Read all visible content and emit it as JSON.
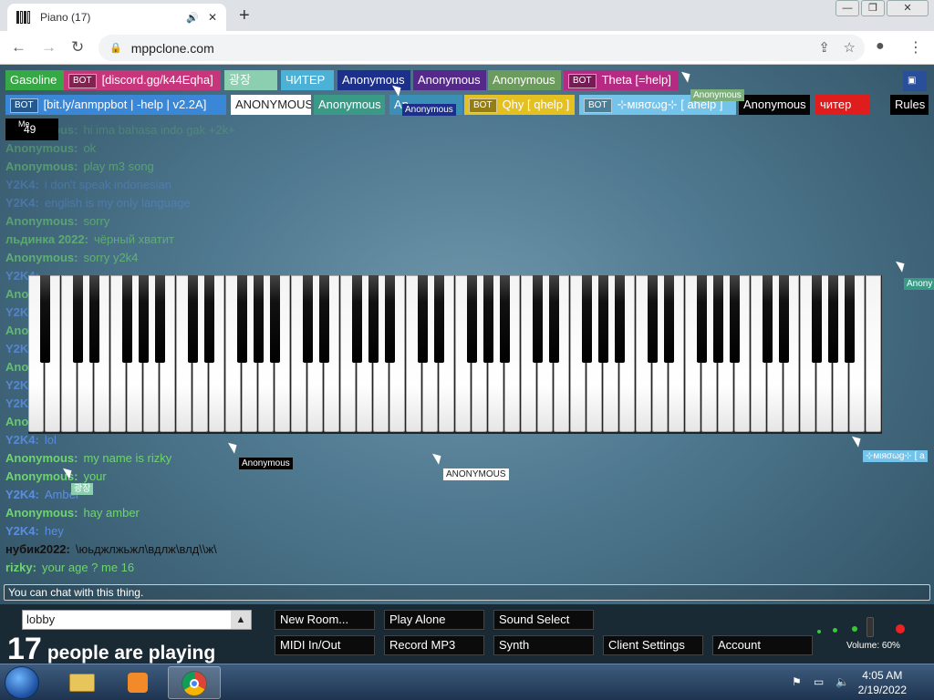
{
  "browser": {
    "tab_title": "Piano (17)",
    "url": "mppclone.com",
    "new_tab": "+",
    "minimize": "—",
    "restore": "❐",
    "close": "✕"
  },
  "users_row1": [
    {
      "name": "Gasoline",
      "bg": "#36a845",
      "bot": false
    },
    {
      "name": "[discord.gg/k44Eqha]",
      "bg": "#c7357a",
      "bot": true
    },
    {
      "name": "광장",
      "bg": "#8ccfb0",
      "bot": false
    },
    {
      "name": "ЧИТЕР",
      "bg": "#4bb1d6",
      "bot": false
    },
    {
      "name": "Anonymous",
      "bg": "#1c2f8a",
      "bot": false
    },
    {
      "name": "Anonymous",
      "bg": "#54298a",
      "bot": false
    },
    {
      "name": "Anonymous",
      "bg": "#6c9b5e",
      "bot": false
    },
    {
      "name": "Theta [=help]",
      "bg": "#b52a82",
      "bot": true
    }
  ],
  "users_row2": [
    {
      "name": "[bit.ly/anmppbot | -help | v2.2A]",
      "bg": "#3a87d8",
      "bot": true
    },
    {
      "name": "ANONYMOUS",
      "bg": "#ffffff",
      "fg": "#222",
      "bot": false
    },
    {
      "name": "Anonymous",
      "bg": "#3b9a86",
      "bot": false
    },
    {
      "name": "An",
      "bg": "#3b8fb6",
      "bot": false
    },
    {
      "name": "Qhy [ qhelp ]",
      "bg": "#e5c021",
      "bot": true
    },
    {
      "name": "⊹мιяσωg⊹ [ ahelp ]",
      "bg": "#74c3ea",
      "bot": true
    },
    {
      "name": "Anonymous",
      "bg": "#050505",
      "bot": false
    },
    {
      "name": "читер",
      "bg": "#e01d1d",
      "bot": false
    }
  ],
  "bot_badge": "BOT",
  "rules_label": "Rules",
  "me": {
    "label": "Me",
    "count": "49"
  },
  "chat": [
    {
      "user": "Anonymous:",
      "text": "hi ima bahasa indo gak +2k+",
      "color": "#6fd46f",
      "fade": 0.25
    },
    {
      "user": "Anonymous:",
      "text": "ok",
      "color": "#6fd46f",
      "fade": 0.4
    },
    {
      "user": "Anonymous:",
      "text": "play m3 song",
      "color": "#6fd46f",
      "fade": 0.5
    },
    {
      "user": "Y2K4:",
      "text": "i don't speak indonesian",
      "color": "#5b8ee0",
      "fade": 0.4
    },
    {
      "user": "Y2K4:",
      "text": "english is my only language",
      "color": "#5b8ee0",
      "fade": 0.45
    },
    {
      "user": "Anonymous:",
      "text": "sorry",
      "color": "#6fd46f",
      "fade": 0.55
    },
    {
      "user": "льдинка 2022:",
      "text": "чёрный хватит",
      "color": "#6fd46f",
      "fade": 0.6
    },
    {
      "user": "Anonymous:",
      "text": "sorry y2k4",
      "color": "#6fd46f",
      "fade": 0.65
    },
    {
      "user": "Y2K4:",
      "text": "",
      "color": "#5b8ee0",
      "fade": 0.7
    },
    {
      "user": "Anonymous:",
      "text": "",
      "color": "#6fd46f",
      "fade": 0.7
    },
    {
      "user": "Y2K4:",
      "text": "",
      "color": "#5b8ee0",
      "fade": 0.75
    },
    {
      "user": "Anonymous:",
      "text": "",
      "color": "#6fd46f",
      "fade": 0.75
    },
    {
      "user": "Y2K4:",
      "text": "",
      "color": "#5b8ee0",
      "fade": 0.8
    },
    {
      "user": "Anonymous:",
      "text": "",
      "color": "#6fd46f",
      "fade": 0.8
    },
    {
      "user": "Y2K4:",
      "text": "",
      "color": "#5b8ee0",
      "fade": 0.85
    },
    {
      "user": "Y2K4:",
      "text": "",
      "color": "#5b8ee0",
      "fade": 0.85
    },
    {
      "user": "Anonymous:",
      "text": "",
      "color": "#6fd46f",
      "fade": 0.9
    },
    {
      "user": "Y2K4:",
      "text": "lol",
      "color": "#5b8ee0",
      "fade": 0.9
    },
    {
      "user": "Anonymous:",
      "text": "my name is rizky",
      "color": "#6fd46f",
      "fade": 1
    },
    {
      "user": "Anonymous:",
      "text": "your",
      "color": "#6fd46f",
      "fade": 1
    },
    {
      "user": "Y2K4:",
      "text": "Amber",
      "color": "#5b8ee0",
      "fade": 1
    },
    {
      "user": "Anonymous:",
      "text": "hay amber",
      "color": "#6fd46f",
      "fade": 1
    },
    {
      "user": "Y2K4:",
      "text": "hey",
      "color": "#5b8ee0",
      "fade": 1
    },
    {
      "user": "нубик2022:",
      "text": "\\юьджлжьжл\\вдлж\\влд\\\\ж\\",
      "color": "#111111",
      "fade": 1
    },
    {
      "user": "rizky:",
      "text": "your age ? me 16",
      "color": "#6fd46f",
      "fade": 1
    }
  ],
  "chat_placeholder": "You can chat with this thing.",
  "cursor_labels": [
    {
      "text": "Anonymous",
      "bg": "#7bb07a"
    },
    {
      "text": "Anonymous",
      "bg": "#1c2f8a"
    },
    {
      "text": "Anony",
      "bg": "#3b9a86"
    },
    {
      "text": "Anonymous",
      "bg": "#050505"
    },
    {
      "text": "ANONYMOUS",
      "bg": "#ffffff",
      "fg": "#222"
    },
    {
      "text": "광장",
      "bg": "#8ccfb0"
    },
    {
      "text": "⊹мιяσωg⊹ [ a",
      "bg": "#74c3ea"
    },
    {
      "text": "Qhy [ qhelp ]",
      "bg": "#e5c021",
      "fg": "#222"
    },
    {
      "text": "Anonymous",
      "bg": "#54298a"
    },
    {
      "text": "[dis",
      "bg": "#c7357a"
    }
  ],
  "room": {
    "name": "lobby",
    "arrow": "▲"
  },
  "people": {
    "count": "17",
    "label": "people are playing"
  },
  "buttons": {
    "new_room": "New Room...",
    "play_alone": "Play Alone",
    "sound_select": "Sound Select",
    "midi": "MIDI In/Out",
    "record": "Record MP3",
    "synth": "Synth",
    "client_settings": "Client Settings",
    "account": "Account"
  },
  "volume": "Volume: 60%",
  "taskbar": {
    "time": "4:05 AM",
    "date": "2/19/2022"
  }
}
